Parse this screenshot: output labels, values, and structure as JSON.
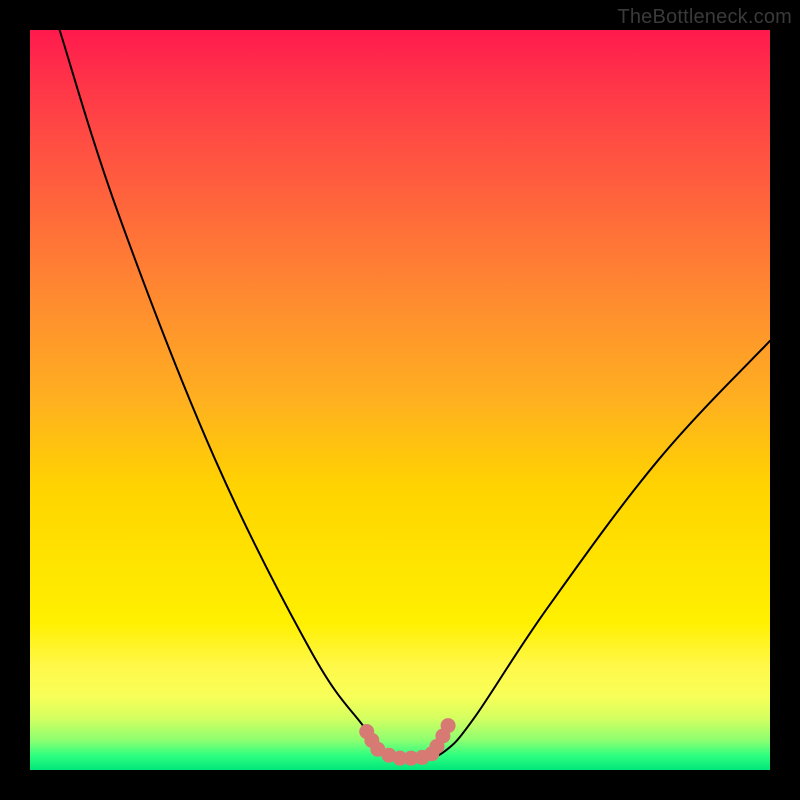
{
  "watermark": "TheBottleneck.com",
  "chart_data": {
    "type": "line",
    "title": "",
    "xlabel": "",
    "ylabel": "",
    "xlim": [
      0,
      100
    ],
    "ylim": [
      0,
      100
    ],
    "background_gradient": {
      "direction": "vertical",
      "stops": [
        {
          "pos": 0,
          "color": "#ff1a4d"
        },
        {
          "pos": 25,
          "color": "#ff6a3a"
        },
        {
          "pos": 50,
          "color": "#ffb020"
        },
        {
          "pos": 75,
          "color": "#ffe400"
        },
        {
          "pos": 93,
          "color": "#d4ff60"
        },
        {
          "pos": 100,
          "color": "#00e67a"
        }
      ]
    },
    "series": [
      {
        "name": "bottleneck-curve",
        "color": "#000000",
        "width": 2,
        "points": [
          {
            "x": 4,
            "y": 100
          },
          {
            "x": 12,
            "y": 75
          },
          {
            "x": 25,
            "y": 42
          },
          {
            "x": 38,
            "y": 16
          },
          {
            "x": 45,
            "y": 6
          },
          {
            "x": 48,
            "y": 2.5
          },
          {
            "x": 50,
            "y": 1.5
          },
          {
            "x": 53,
            "y": 1.5
          },
          {
            "x": 56,
            "y": 2.5
          },
          {
            "x": 60,
            "y": 7
          },
          {
            "x": 70,
            "y": 22
          },
          {
            "x": 85,
            "y": 42
          },
          {
            "x": 100,
            "y": 58
          }
        ]
      },
      {
        "name": "trough-markers",
        "color": "#d87a74",
        "type": "scatter",
        "points": [
          {
            "x": 45.5,
            "y": 5.2
          },
          {
            "x": 46.2,
            "y": 4.0
          },
          {
            "x": 47.0,
            "y": 2.8
          },
          {
            "x": 48.5,
            "y": 2.0
          },
          {
            "x": 50.0,
            "y": 1.6
          },
          {
            "x": 51.5,
            "y": 1.6
          },
          {
            "x": 53.0,
            "y": 1.7
          },
          {
            "x": 54.3,
            "y": 2.2
          },
          {
            "x": 55.0,
            "y": 3.2
          },
          {
            "x": 55.8,
            "y": 4.6
          },
          {
            "x": 56.5,
            "y": 6.0
          }
        ]
      }
    ]
  }
}
